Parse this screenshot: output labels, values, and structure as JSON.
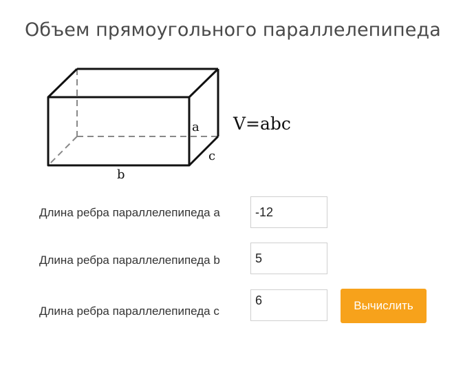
{
  "page": {
    "title": "Объем прямоугольного параллелепипеда"
  },
  "diagram": {
    "formula": "V=abc",
    "edge_a": "a",
    "edge_b": "b",
    "edge_c": "c"
  },
  "form": {
    "fields": [
      {
        "label": "Длина ребра параллелепипеда a",
        "value": "-12"
      },
      {
        "label": "Длина ребра параллелепипеда b",
        "value": "5"
      },
      {
        "label": "Длина ребра параллелепипеда c",
        "value": "6"
      }
    ],
    "submit_label": "Вычислить"
  },
  "colors": {
    "button_bg": "#f7a21b",
    "button_text": "#ffffff",
    "title_text": "#4a4a4a"
  }
}
